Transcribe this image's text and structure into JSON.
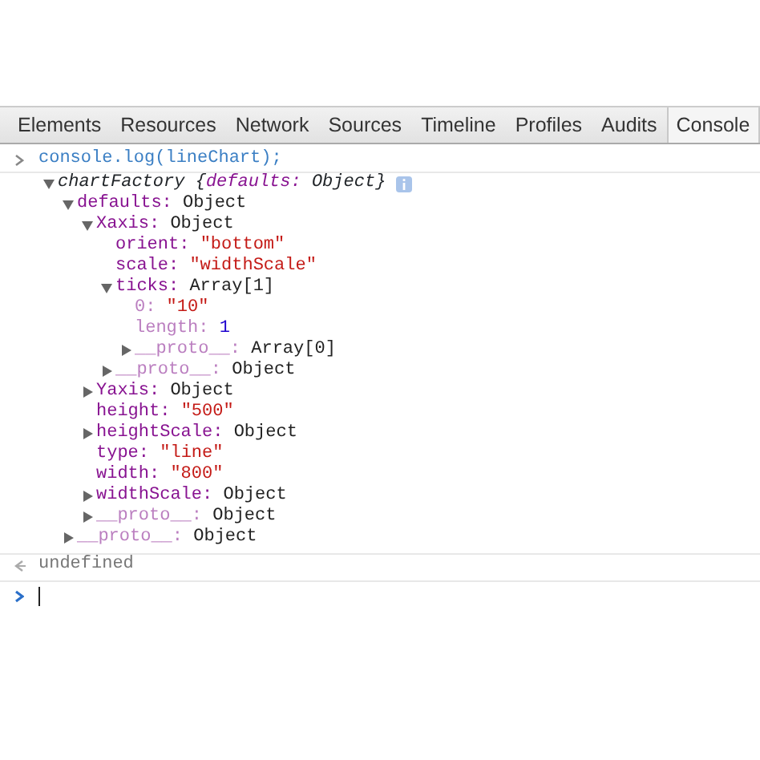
{
  "tabs": [
    {
      "label": "Elements",
      "selected": false
    },
    {
      "label": "Resources",
      "selected": false
    },
    {
      "label": "Network",
      "selected": false
    },
    {
      "label": "Sources",
      "selected": false
    },
    {
      "label": "Timeline",
      "selected": false
    },
    {
      "label": "Profiles",
      "selected": false
    },
    {
      "label": "Audits",
      "selected": false
    },
    {
      "label": "Console",
      "selected": true
    }
  ],
  "console": [
    {
      "kind": "input",
      "text": "console.log(lineChart);"
    },
    {
      "kind": "object",
      "class_name": "chartFactory",
      "preview": {
        "open": "{",
        "key": "defaults:",
        "value": "Object",
        "close": "}"
      },
      "expanded": true,
      "children": [
        {
          "key": "defaults:",
          "value": "Object",
          "kind": "object",
          "expanded": true,
          "children": [
            {
              "key": "Xaxis:",
              "value": "Object",
              "kind": "object",
              "expanded": true,
              "children": [
                {
                  "key": "orient:",
                  "value": "\"bottom\"",
                  "kind": "string"
                },
                {
                  "key": "scale:",
                  "value": "\"widthScale\"",
                  "kind": "string"
                },
                {
                  "key": "ticks:",
                  "value": "Array[1]",
                  "kind": "object",
                  "expanded": true,
                  "children": [
                    {
                      "key": "0:",
                      "value": "\"10\"",
                      "kind": "string",
                      "internal": true
                    },
                    {
                      "key": "length:",
                      "value": "1",
                      "kind": "number",
                      "internal": true
                    },
                    {
                      "key": "__proto__:",
                      "value": "Array[0]",
                      "kind": "object",
                      "internal": true,
                      "expanded": false
                    }
                  ]
                },
                {
                  "key": "__proto__:",
                  "value": "Object",
                  "kind": "object",
                  "internal": true,
                  "expanded": false
                }
              ]
            },
            {
              "key": "Yaxis:",
              "value": "Object",
              "kind": "object",
              "expanded": false
            },
            {
              "key": "height:",
              "value": "\"500\"",
              "kind": "string"
            },
            {
              "key": "heightScale:",
              "value": "Object",
              "kind": "object",
              "expanded": false
            },
            {
              "key": "type:",
              "value": "\"line\"",
              "kind": "string"
            },
            {
              "key": "width:",
              "value": "\"800\"",
              "kind": "string"
            },
            {
              "key": "widthScale:",
              "value": "Object",
              "kind": "object",
              "expanded": false
            },
            {
              "key": "__proto__:",
              "value": "Object",
              "kind": "object",
              "internal": true,
              "expanded": false
            }
          ]
        },
        {
          "key": "__proto__:",
          "value": "Object",
          "kind": "object",
          "internal": true,
          "expanded": false
        }
      ]
    },
    {
      "kind": "result",
      "text": "undefined"
    },
    {
      "kind": "prompt"
    }
  ]
}
